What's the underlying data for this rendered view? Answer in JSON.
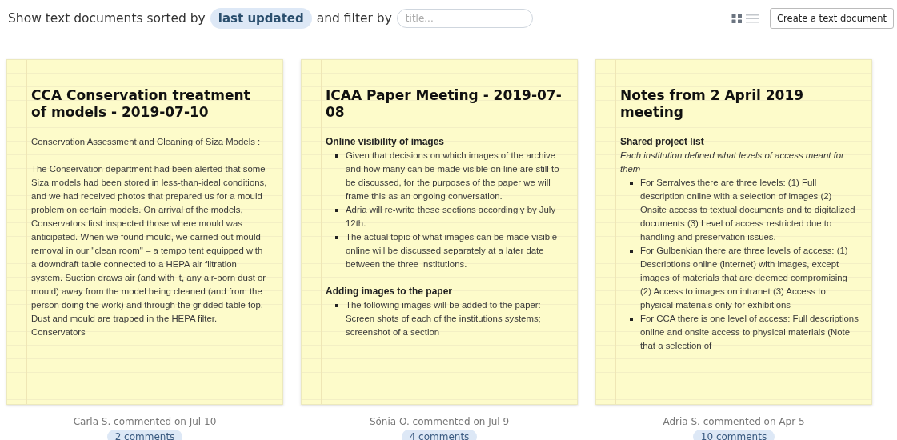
{
  "toolbar": {
    "sort_prefix": "Show text documents sorted by",
    "sort_option": {
      "label": "last updated",
      "selected": true
    },
    "filter_prefix": "and filter by",
    "filter": {
      "placeholder": "title..."
    },
    "view_modes": [
      {
        "kind": "grid",
        "selected": true
      },
      {
        "kind": "list",
        "selected": false
      }
    ],
    "create_button": "Create a text document"
  },
  "documents": [
    {
      "title": "CCA Conservation treatment of models - 2019-07-10",
      "blocks": [
        {
          "kind": "paragraph",
          "text": "Conservation Assessment and Cleaning of Siza Models :"
        },
        {
          "kind": "paragraph",
          "text": "The Conservation department had been alerted that some Siza models had been stored in less-than-ideal conditions, and we had received photos that prepared us for a mould problem on certain models.  On arrival of the models, Conservators first inspected those where mould was anticipated.  When we found mould, we carried out mould removal in our \"clean room\" – a tempo tent equipped with a downdraft table connected to a HEPA air filtration system. Suction draws air (and with it, any air-born dust or mould) away from the model being cleaned (and from the person doing the work) and through the gridded table top. Dust and mould are trapped in the HEPA filter. Conservators"
        }
      ],
      "last_comment": "Carla S. commented on Jul 10",
      "comments": "2 comments"
    },
    {
      "title": "ICAA Paper Meeting - 2019-07-08",
      "blocks": [
        {
          "kind": "heading",
          "text": "Online visibility of images"
        },
        {
          "kind": "list",
          "items": [
            "Given that decisions on which images of the archive and how many can be made visible on line are still to be discussed, for the purposes of the paper we will frame this as an ongoing conversation.",
            "Adria will re-write these sections accordingly by July 12th.",
            "The actual topic of what images can be made visible online will be discussed separately at a later date between the three institutions."
          ]
        },
        {
          "kind": "heading",
          "text": "Adding images to the paper"
        },
        {
          "kind": "list",
          "items": [
            "The following images will be added to the paper: Screen shots of each of the institutions systems; screenshot of a section"
          ]
        }
      ],
      "last_comment": "Sónia O. commented on Jul 9",
      "comments": "4 comments"
    },
    {
      "title": "Notes from 2 April 2019 meeting",
      "blocks": [
        {
          "kind": "heading",
          "text": "Shared project list"
        },
        {
          "kind": "note",
          "text": "Each institution defined what levels of access meant for them"
        },
        {
          "kind": "list",
          "items": [
            "For Serralves there are three levels: (1) Full description online with a selection of images (2) Onsite access to textual documents and to digitalized documents (3) Level of access restricted due to handling and preservation issues.",
            "For Gulbenkian there are three levels of access: (1) Descriptions online (internet) with images, except images of materials that are deemed compromising (2) Access to images on intranet (3) Access to physical materials only for exhibitions",
            "For CCA there is one level of access: Full descriptions online and onsite access to physical materials (Note that a selection of"
          ]
        }
      ],
      "last_comment": "Adria S. commented on Apr 5",
      "comments": "10 comments"
    }
  ]
}
